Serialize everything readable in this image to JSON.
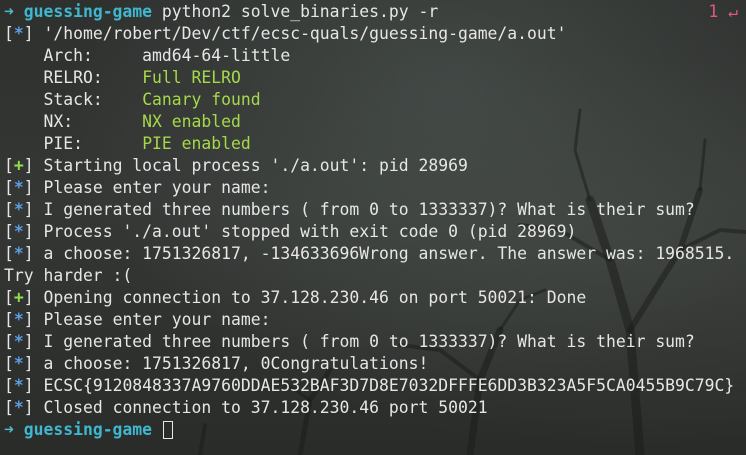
{
  "prompt": {
    "arrow": "➜",
    "cwd": "guessing-game",
    "command": "python2 solve_binaries.py -r",
    "exit_status": "1 ↵",
    "final_cwd": "guessing-game"
  },
  "markers": {
    "info": "*",
    "good": "+"
  },
  "checksec": {
    "path_line": "'/home/robert/Dev/ctf/ecsc-quals/guessing-game/a.out'",
    "rows": [
      {
        "label": "Arch:",
        "value": "amd64-64-little"
      },
      {
        "label": "RELRO:",
        "value": "Full RELRO"
      },
      {
        "label": "Stack:",
        "value": "Canary found"
      },
      {
        "label": "NX:",
        "value": "NX enabled"
      },
      {
        "label": "PIE:",
        "value": "PIE enabled"
      }
    ]
  },
  "output": [
    {
      "marker": "+",
      "text": "Starting local process './a.out': pid 28969"
    },
    {
      "marker": "*",
      "text": "Please enter your name:"
    },
    {
      "marker": "*",
      "text": "I generated three numbers ( from 0 to 1333337)? What is their sum?"
    },
    {
      "marker": "*",
      "text": "Process './a.out' stopped with exit code 0 (pid 28969)"
    },
    {
      "marker": "*",
      "text": "a choose: 1751326817, -134633696Wrong answer. The answer was: 1968515."
    },
    {
      "marker": "",
      "text": "Try harder :("
    },
    {
      "marker": "+",
      "text": "Opening connection to 37.128.230.46 on port 50021: Done"
    },
    {
      "marker": "*",
      "text": "Please enter your name:"
    },
    {
      "marker": "*",
      "text": "I generated three numbers ( from 0 to 1333337)? What is their sum?"
    },
    {
      "marker": "*",
      "text": "a choose: 1751326817, 0Congratulations!"
    },
    {
      "marker": "*",
      "text": "ECSC{9120848337A9760DDAE532BAF3D7D8E7032DFFFE6DD3B323A5F5CA0455B9C79C}"
    },
    {
      "marker": "*",
      "text": "Closed connection to 37.128.230.46 port 50021"
    }
  ]
}
